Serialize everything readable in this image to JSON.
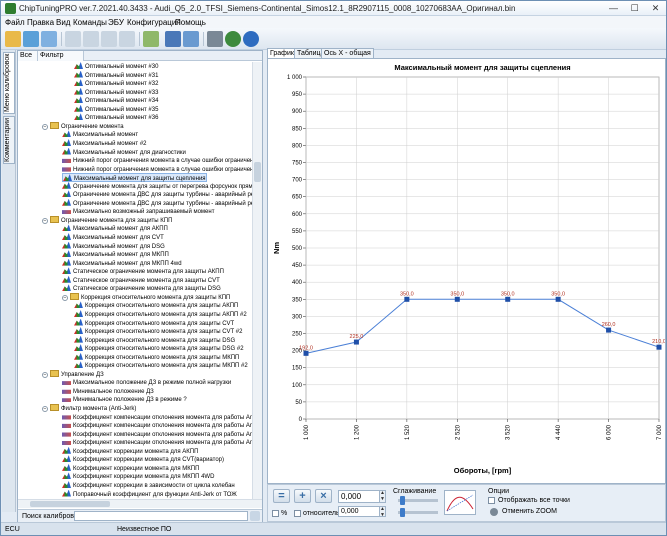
{
  "window": {
    "title": "ChipTuningPRO ver.7.2021.40.3433 - Audi_Q5_2.0_TFSI_Siemens-Continental_Simos12.1_8R2907115_0008_10270683AA_Оригинал.bin",
    "min": "—",
    "max": "☐",
    "close": "✕"
  },
  "menu": [
    "Файл",
    "Правка",
    "Вид",
    "Команды",
    "ЭБУ",
    "Конфигурация",
    "Помощь"
  ],
  "left_tabs": [
    "Меню калибровок",
    "Комментарии"
  ],
  "filter_tabs": [
    "Все",
    "Фильтр"
  ],
  "tree": [
    {
      "label": "Оптимальный момент #30",
      "level": 3,
      "type": "leaf"
    },
    {
      "label": "Оптимальный момент #31",
      "level": 3,
      "type": "leaf"
    },
    {
      "label": "Оптимальный момент #32",
      "level": 3,
      "type": "leaf"
    },
    {
      "label": "Оптимальный момент #33",
      "level": 3,
      "type": "leaf"
    },
    {
      "label": "Оптимальный момент #34",
      "level": 3,
      "type": "leaf"
    },
    {
      "label": "Оптимальный момент #35",
      "level": 3,
      "type": "leaf"
    },
    {
      "label": "Оптимальный момент #36",
      "level": 3,
      "type": "leaf"
    },
    {
      "label": "Ограничение момента",
      "level": 1,
      "type": "folder"
    },
    {
      "label": "Максимальный момент",
      "level": 2,
      "type": "leaf"
    },
    {
      "label": "Максимальный момент #2",
      "level": 2,
      "type": "leaf"
    },
    {
      "label": "Максимальный момент для диагностики",
      "level": 2,
      "type": "leaf"
    },
    {
      "label": "Нижний порог ограничения момента в случае ошибки ограничения",
      "level": 2,
      "type": "flat"
    },
    {
      "label": "Нижний порог ограничения момента в случае ошибки ограничения",
      "level": 2,
      "type": "flat"
    },
    {
      "label": "Максимальный момент для защиты сцепления",
      "level": 2,
      "type": "leaf",
      "selected": true
    },
    {
      "label": "Ограничение момента для защиты от перегрева форсунок прямого",
      "level": 2,
      "type": "leaf"
    },
    {
      "label": "Ограничение момента ДВС для защиты турбины - аварийный режим",
      "level": 2,
      "type": "leaf"
    },
    {
      "label": "Ограничение момента ДВС для защиты турбины - аварийный режим",
      "level": 2,
      "type": "leaf"
    },
    {
      "label": "Максимально возможный запрашиваемый момент",
      "level": 2,
      "type": "flat"
    },
    {
      "label": "Ограничение момента для защиты КПП",
      "level": 1,
      "type": "folder"
    },
    {
      "label": "Максимальный момент для АКПП",
      "level": 2,
      "type": "leaf"
    },
    {
      "label": "Максимальный момент для CVT",
      "level": 2,
      "type": "leaf"
    },
    {
      "label": "Максимальный момент для DSG",
      "level": 2,
      "type": "leaf"
    },
    {
      "label": "Максимальный момент для МКПП",
      "level": 2,
      "type": "leaf"
    },
    {
      "label": "Максимальный момент для МКПП 4wd",
      "level": 2,
      "type": "leaf"
    },
    {
      "label": "Статическое ограничение момента для защиты АКПП",
      "level": 2,
      "type": "leaf"
    },
    {
      "label": "Статическое ограничение момента для защиты CVT",
      "level": 2,
      "type": "leaf"
    },
    {
      "label": "Статическое ограничение момента для защиты DSG",
      "level": 2,
      "type": "leaf"
    },
    {
      "label": "Коррекция относительного момента для защиты КПП",
      "level": 2,
      "type": "folder"
    },
    {
      "label": "Коррекция относительного момента для защиты АКПП",
      "level": 3,
      "type": "leaf"
    },
    {
      "label": "Коррекция относительного момента для защиты АКПП #2",
      "level": 3,
      "type": "leaf"
    },
    {
      "label": "Коррекция относительного момента для защиты CVT",
      "level": 3,
      "type": "leaf"
    },
    {
      "label": "Коррекция относительного момента для защиты CVT #2",
      "level": 3,
      "type": "leaf"
    },
    {
      "label": "Коррекция относительного момента для защиты DSG",
      "level": 3,
      "type": "leaf"
    },
    {
      "label": "Коррекция относительного момента для защиты DSG #2",
      "level": 3,
      "type": "leaf"
    },
    {
      "label": "Коррекция относительного момента для защиты МКПП",
      "level": 3,
      "type": "leaf"
    },
    {
      "label": "Коррекция относительного момента для защиты МКПП #2",
      "level": 3,
      "type": "leaf"
    },
    {
      "label": "Управление ДЗ",
      "level": 1,
      "type": "folder"
    },
    {
      "label": "Максимальное положение ДЗ в режиме полной нагрузки",
      "level": 2,
      "type": "flat"
    },
    {
      "label": "Минимальное положение ДЗ",
      "level": 2,
      "type": "flat"
    },
    {
      "label": "Минимальное положение ДЗ в режиме ?",
      "level": 2,
      "type": "flat"
    },
    {
      "label": "Фильтр момента (Anti-Jerk)",
      "level": 1,
      "type": "folder"
    },
    {
      "label": "Коэффициент компенсации отклонения момента для работы Anti-J",
      "level": 2,
      "type": "flat"
    },
    {
      "label": "Коэффициент компенсации отклонения момента для работы Anti-J",
      "level": 2,
      "type": "flat"
    },
    {
      "label": "Коэффициент компенсации отклонения момента для работы Anti-J",
      "level": 2,
      "type": "flat"
    },
    {
      "label": "Коэффициент компенсации отклонения момента для работы Anti-J",
      "level": 2,
      "type": "flat"
    },
    {
      "label": "Коэффициент коррекции момента для АКПП",
      "level": 2,
      "type": "leaf"
    },
    {
      "label": "Коэффициент коррекции момента для CVT(вариатор)",
      "level": 2,
      "type": "leaf"
    },
    {
      "label": "Коэффициент коррекции момента для МКПП",
      "level": 2,
      "type": "leaf"
    },
    {
      "label": "Коэффициент коррекции момента для МКПП 4WD",
      "level": 2,
      "type": "leaf"
    },
    {
      "label": "Коэффициент коррекции в зависимости от цикла колебан",
      "level": 2,
      "type": "leaf"
    },
    {
      "label": "Поправочный коэффициент для функции Anti-Jerk от ТОЖ",
      "level": 2,
      "type": "leaf"
    }
  ],
  "search": {
    "label": "Поиск калибровки",
    "value": ""
  },
  "right_tabs": [
    "График",
    "Таблица",
    "Ось X - общая"
  ],
  "chart_data": {
    "type": "line",
    "title": "Максимальный момент для защиты сцепления",
    "xlabel": "Обороты, [rpm]",
    "ylabel": "Nm",
    "x": [
      1000,
      1200,
      1520,
      2520,
      3520,
      4440,
      6000,
      7000
    ],
    "values": [
      192.0,
      225.0,
      350.0,
      350.0,
      350.0,
      350.0,
      260.0,
      210.0
    ],
    "data_labels": [
      "192,0",
      "225,0",
      "350,0",
      "350,0",
      "350,0",
      "350,0",
      "260,0",
      "210,0"
    ],
    "x_tick_labels": [
      "1 000",
      "1 200",
      "1 520",
      "2 520",
      "3 520",
      "4 440",
      "6 000",
      "7 000"
    ],
    "y_ticks": [
      0,
      50,
      100,
      150,
      200,
      250,
      300,
      350,
      400,
      450,
      500,
      550,
      600,
      650,
      700,
      750,
      800,
      850,
      900,
      950,
      1000
    ],
    "y_tick_labels": [
      "0",
      "50",
      "100",
      "150",
      "200",
      "250",
      "300",
      "350",
      "400",
      "450",
      "500",
      "550",
      "600",
      "650",
      "700",
      "750",
      "800",
      "850",
      "900",
      "950",
      "1 000"
    ],
    "ylim": [
      0,
      1000
    ],
    "grid": true,
    "line_color": "#4a7fd6",
    "marker_color": "#1f4fa8",
    "label_color": "#b03020"
  },
  "bottom": {
    "value1": "0,000",
    "percent_label": "%",
    "relative_label": "относительно",
    "value2": "0,000",
    "smoothing_label": "Сглаживание",
    "options_label": "Опции",
    "show_all_points": "Отображать все точки",
    "cancel_zoom": "Отменить ZOOM"
  },
  "status": [
    "ECU",
    "Неизвестное ПО"
  ]
}
